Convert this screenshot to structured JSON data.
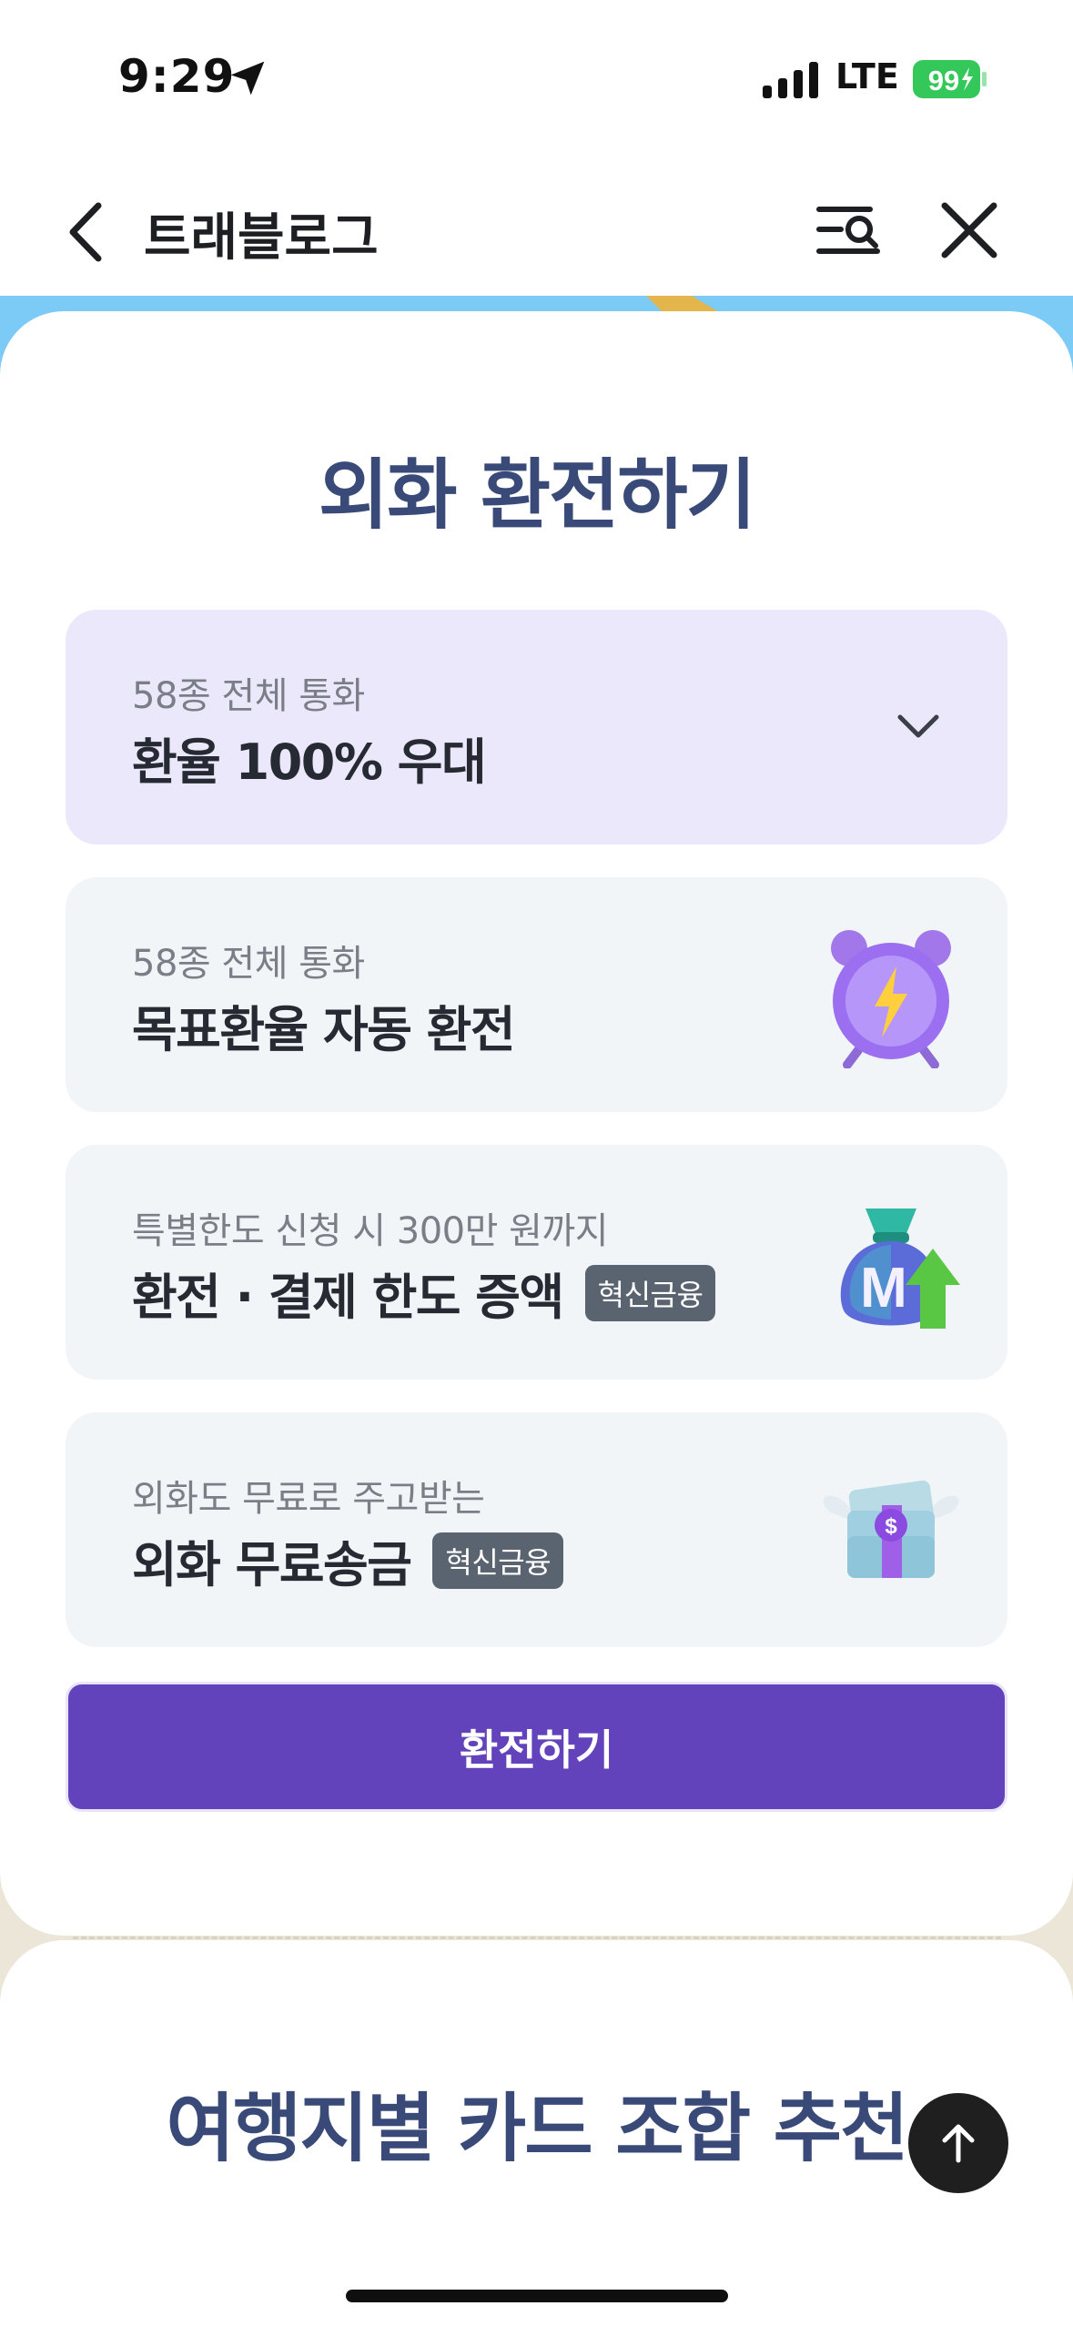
{
  "status_bar": {
    "time": "9:29",
    "network": "LTE",
    "battery": "99"
  },
  "header": {
    "title": "트래블로그"
  },
  "exchange": {
    "title": "외화 환전하기",
    "options": [
      {
        "sub": "58종 전체 통화",
        "main": "환율 100% 우대",
        "badge": ""
      },
      {
        "sub": "58종 전체 통화",
        "main": "목표환율 자동 환전",
        "badge": ""
      },
      {
        "sub": "특별한도 신청 시 300만 원까지",
        "main": "환전 · 결제 한도 증액",
        "badge": "혁신금융"
      },
      {
        "sub": "외화도 무료로 주고받는",
        "main": "외화 무료송금",
        "badge": "혁신금융"
      }
    ],
    "cta": "환전하기"
  },
  "recommend": {
    "title": "여행지별 카드 조합 추천"
  },
  "colors": {
    "accent": "#6243bc",
    "title": "#3a4a78",
    "sky": "#7ccaf6",
    "beige": "#ece6d8",
    "battery": "#34c759"
  }
}
